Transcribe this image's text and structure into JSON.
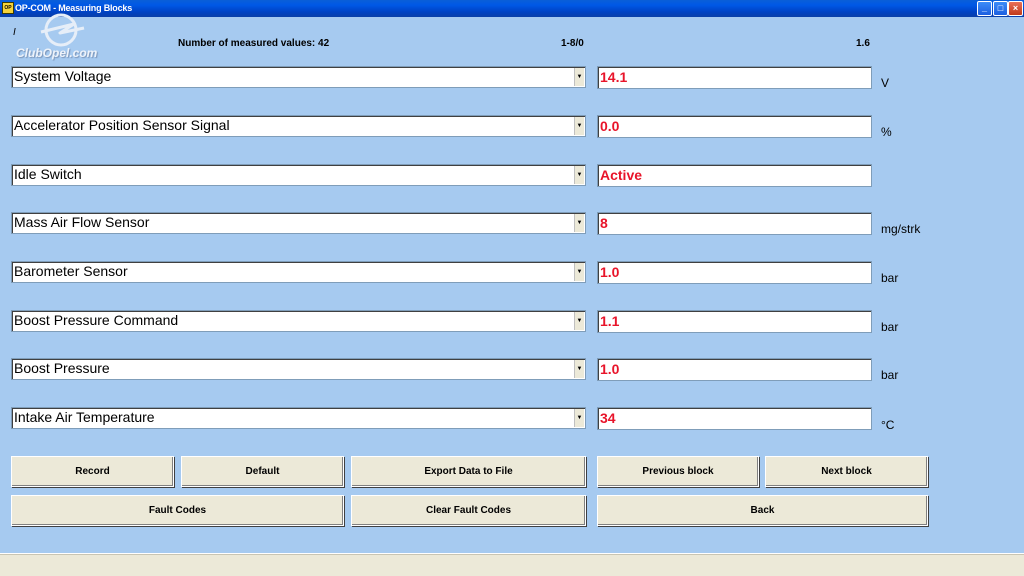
{
  "window": {
    "app_icon_text": "OP",
    "title": "OP-COM - Measuring Blocks",
    "minimize": "_",
    "maximize": "□",
    "close": "×"
  },
  "header": {
    "cursor_mark": "I",
    "measured_count": "Number of measured values: 42",
    "range": "1-8/0",
    "version": "1.6"
  },
  "logo": {
    "text": "ClubOpel.com"
  },
  "rows": [
    {
      "label": "System Voltage",
      "value": "14.1",
      "unit": "V"
    },
    {
      "label": "Accelerator Position Sensor Signal",
      "value": "0.0",
      "unit": "%"
    },
    {
      "label": "Idle Switch",
      "value": "Active",
      "unit": ""
    },
    {
      "label": "Mass Air Flow Sensor",
      "value": "8",
      "unit": "mg/strk"
    },
    {
      "label": "Barometer Sensor",
      "value": "1.0",
      "unit": "bar"
    },
    {
      "label": "Boost Pressure Command",
      "value": "1.1",
      "unit": "bar"
    },
    {
      "label": "Boost Pressure",
      "value": "1.0",
      "unit": "bar"
    },
    {
      "label": "Intake Air Temperature",
      "value": "34",
      "unit": "°C"
    }
  ],
  "buttons": {
    "record": "Record",
    "default": "Default",
    "export": "Export Data to File",
    "previous": "Previous block",
    "next": "Next block",
    "fault_codes": "Fault Codes",
    "clear_fault_codes": "Clear Fault Codes",
    "back": "Back"
  },
  "colors": {
    "background": "#a6caf0",
    "value_text": "#e8142a"
  }
}
